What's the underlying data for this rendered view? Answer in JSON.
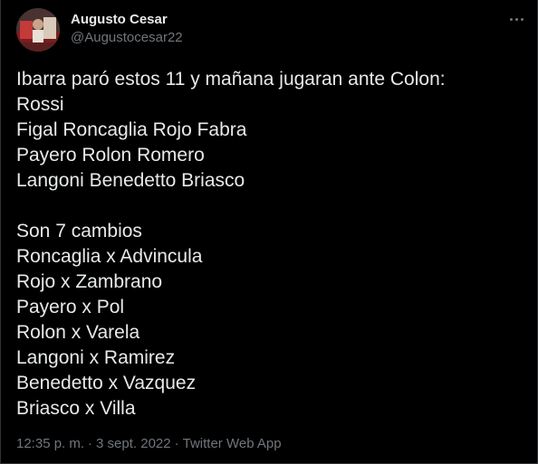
{
  "author": {
    "name": "Augusto Cesar",
    "handle": "@Augustocesar22",
    "avatar": "avatar-photo"
  },
  "more_icon": "more-horizontal-icon",
  "tweet": {
    "lines": [
      "Ibarra paró estos 11 y mañana jugaran ante Colon:",
      "Rossi",
      "Figal Roncaglia Rojo Fabra",
      "Payero Rolon Romero",
      "Langoni Benedetto Briasco",
      "",
      "Son 7 cambios",
      "Roncaglia x Advincula",
      "Rojo x Zambrano",
      "Payero x Pol",
      "Rolon x Varela",
      "Langoni x Ramirez",
      "Benedetto x Vazquez",
      "Briasco x Villa"
    ]
  },
  "meta": {
    "time": "12:35 p. m.",
    "separator": "·",
    "date": "3 sept. 2022",
    "source": "Twitter Web App"
  },
  "colors": {
    "background": "#000000",
    "text": "#e7e9ea",
    "secondary": "#71767b",
    "border": "#2f3336"
  }
}
